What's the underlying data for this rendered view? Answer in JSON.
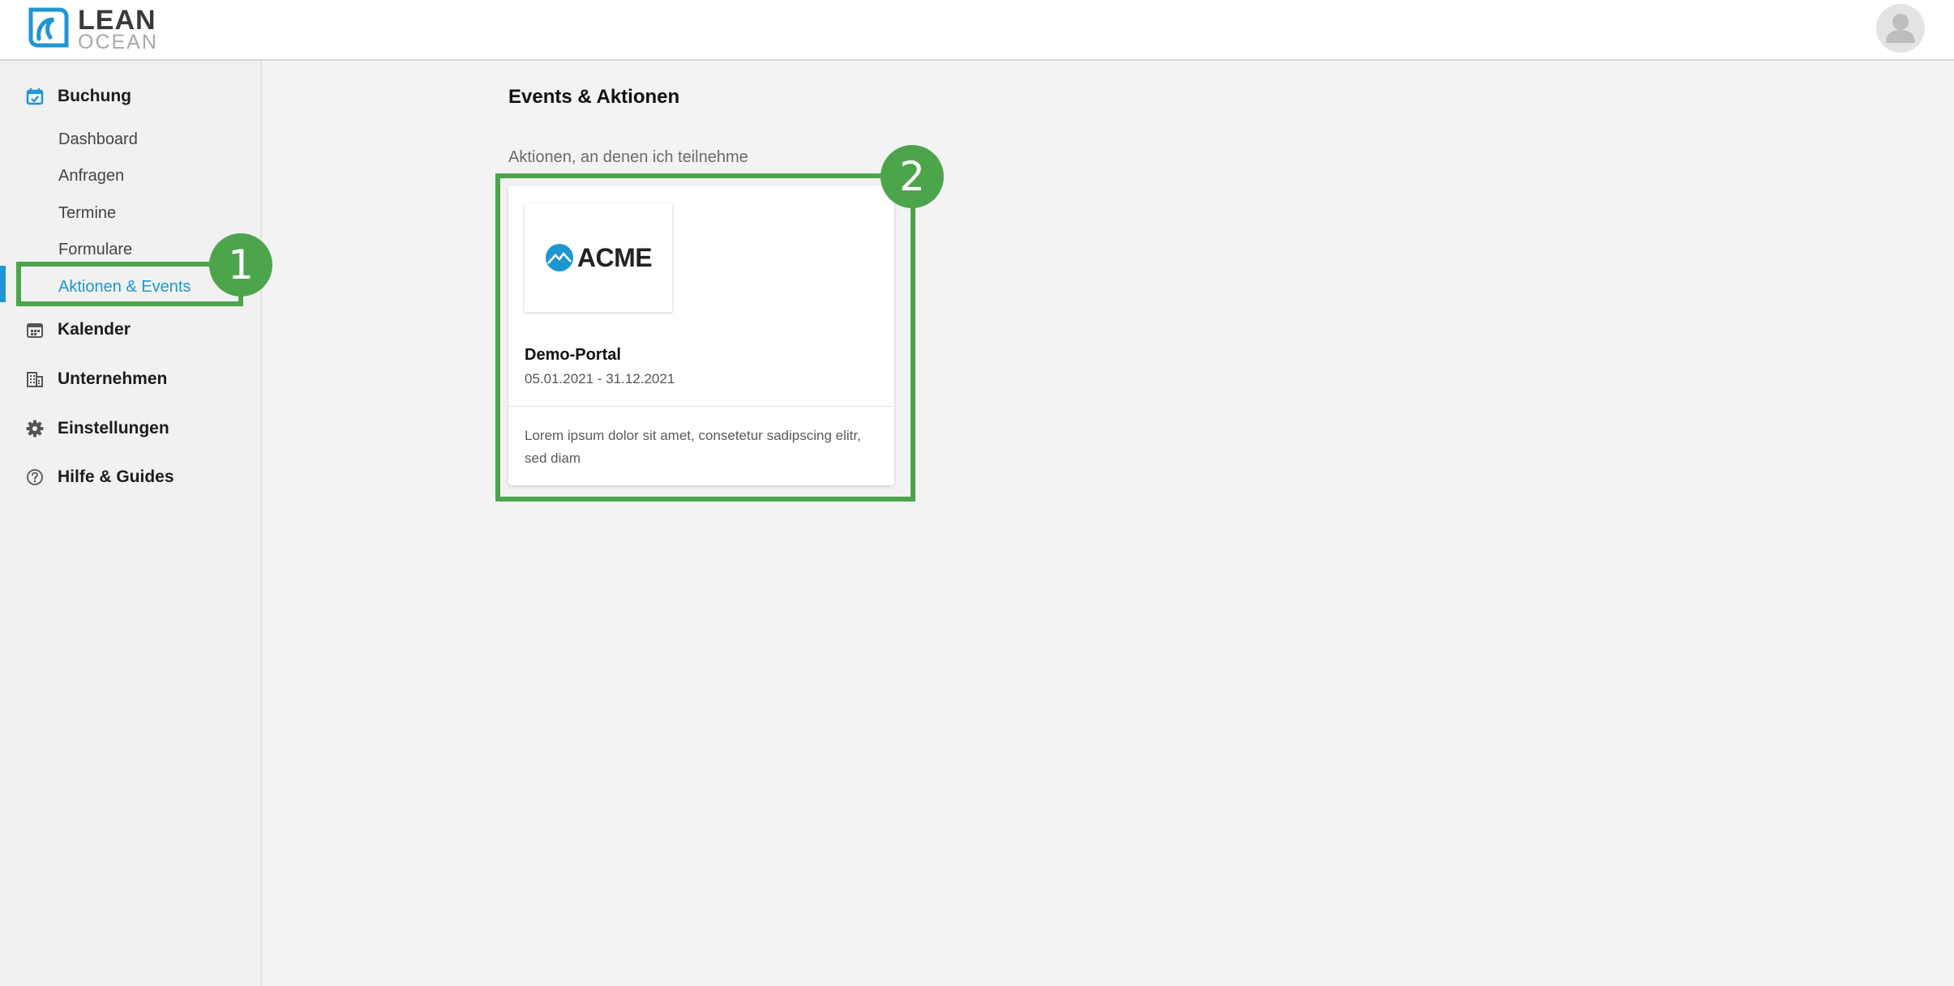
{
  "header": {
    "logo": {
      "line1": "LEAN",
      "line2": "OCEAN"
    }
  },
  "sidebar": {
    "sections": [
      {
        "label": "Buchung",
        "icon": "calendar-check-icon"
      },
      {
        "label": "Kalender",
        "icon": "calendar-icon"
      },
      {
        "label": "Unternehmen",
        "icon": "building-icon"
      },
      {
        "label": "Einstellungen",
        "icon": "gear-icon"
      },
      {
        "label": "Hilfe & Guides",
        "icon": "help-circle-icon"
      }
    ],
    "buchung_items": [
      {
        "label": "Dashboard"
      },
      {
        "label": "Anfragen"
      },
      {
        "label": "Termine"
      },
      {
        "label": "Formulare"
      },
      {
        "label": "Aktionen & Events",
        "active": true
      }
    ]
  },
  "main": {
    "title": "Events & Aktionen",
    "section_label": "Aktionen, an denen ich teilnehme",
    "card": {
      "logo_text": "ACME",
      "title": "Demo-Portal",
      "date": "05.01.2021 - 31.12.2021",
      "description": "Lorem ipsum dolor sit amet, consetetur sadipscing elitr, sed diam"
    }
  },
  "annotations": [
    {
      "number": "1"
    },
    {
      "number": "2"
    }
  ],
  "colors": {
    "accent": "#1e96d3",
    "annotation": "#4da54b",
    "background": "#f3f3f3"
  }
}
